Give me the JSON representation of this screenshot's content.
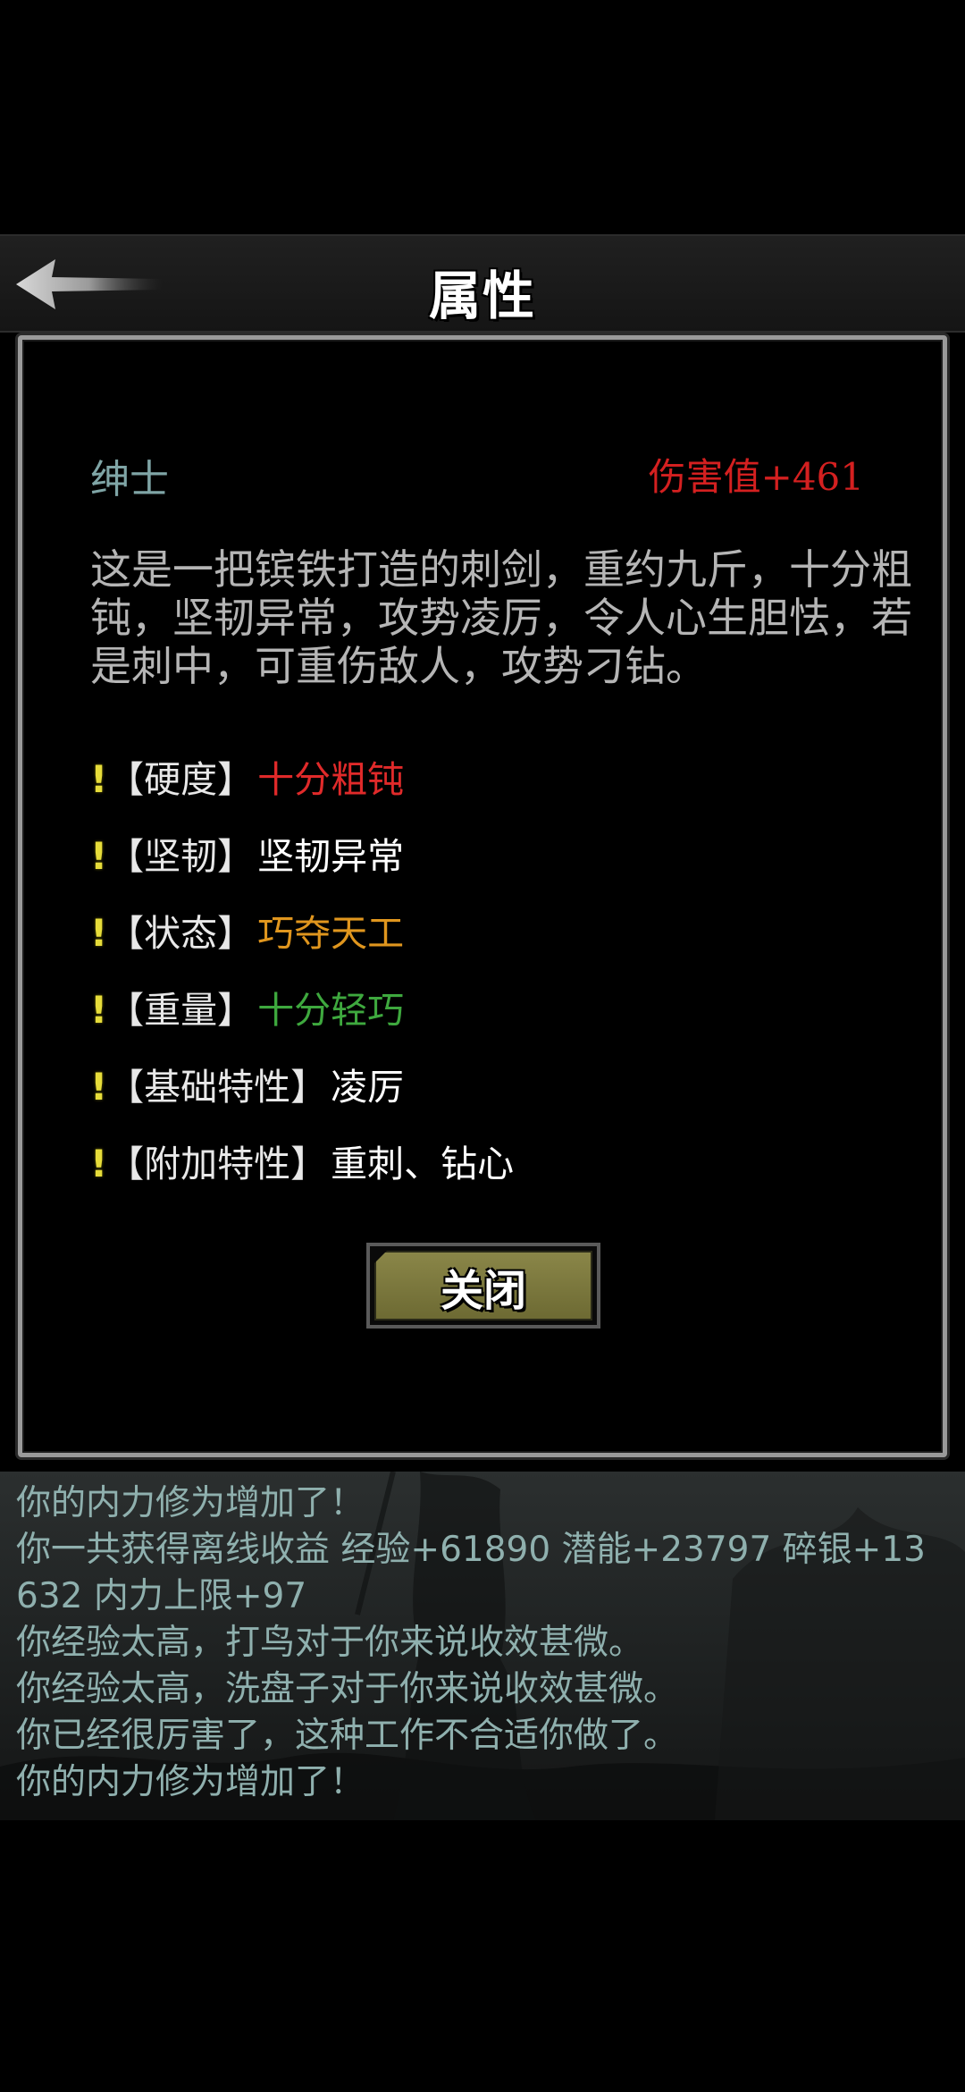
{
  "header": {
    "title": "属性"
  },
  "item": {
    "name": "绅士",
    "damage": "伤害值+461",
    "description": "这是一把镔铁打造的刺剑，重约九斤，十分粗钝，坚韧异常，攻势凌厉，令人心生胆怯，若是刺中，可重伤敌人，攻势刁钻。"
  },
  "attributes": [
    {
      "mark": "!",
      "key": "【硬度】",
      "value": "十分粗钝",
      "color": "#e02a2a"
    },
    {
      "mark": "!",
      "key": "【坚韧】",
      "value": "坚韧异常",
      "color": "#ffffff"
    },
    {
      "mark": "!",
      "key": "【状态】",
      "value": "巧夺天工",
      "color": "#e0961e"
    },
    {
      "mark": "!",
      "key": "【重量】",
      "value": "十分轻巧",
      "color": "#3ea83e"
    },
    {
      "mark": "!",
      "key": "【基础特性】",
      "value": "凌厉",
      "color": "#ffffff"
    },
    {
      "mark": "!",
      "key": "【附加特性】",
      "value": "重刺、钻心",
      "color": "#ffffff"
    }
  ],
  "close_button": {
    "label": "关闭"
  },
  "log": [
    "你的内力修为增加了！",
    "你一共获得离线收益 经验+61890 潜能+23797 碎银+13632 内力上限+97",
    "你经验太高，打鸟对于你来说收效甚微。",
    "你经验太高，洗盘子对于你来说收效甚微。",
    "你已经很厉害了，这种工作不合适你做了。",
    "你的内力修为增加了！"
  ],
  "icons": {
    "back": "back-arrow-icon"
  },
  "colors": {
    "accent_red": "#d42020",
    "name_teal": "#7fa5a6",
    "log_text": "#8fb0ae",
    "button_olive": "#7d7a3e"
  }
}
